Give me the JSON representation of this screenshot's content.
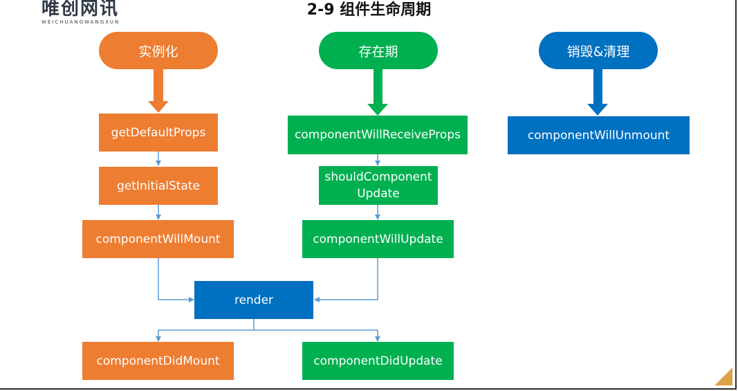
{
  "logo": {
    "cn": "唯创网讯",
    "en": "WEICHUANGWANGXUN"
  },
  "title": "2-9  组件生命周期",
  "phases": {
    "mount": "实例化",
    "update": "存在期",
    "unmount": "销毁&清理"
  },
  "nodes": {
    "get_default_props": "getDefaultProps",
    "get_initial_state": "getInitialState",
    "component_will_mount": "componentWillMount",
    "render": "render",
    "component_did_mount": "componentDidMount",
    "component_will_receive_props": "componentWillReceiveProps",
    "should_component_update_line1": "shouldComponent",
    "should_component_update_line2": "Update",
    "component_will_update": "componentWillUpdate",
    "component_did_update": "componentDidUpdate",
    "component_will_unmount": "componentWillUnmount"
  },
  "colors": {
    "mount": "#ed7d31",
    "update": "#00b050",
    "unmount": "#0070c0",
    "connector": "#5b9bd5",
    "corner_mark": "#dca34a"
  }
}
